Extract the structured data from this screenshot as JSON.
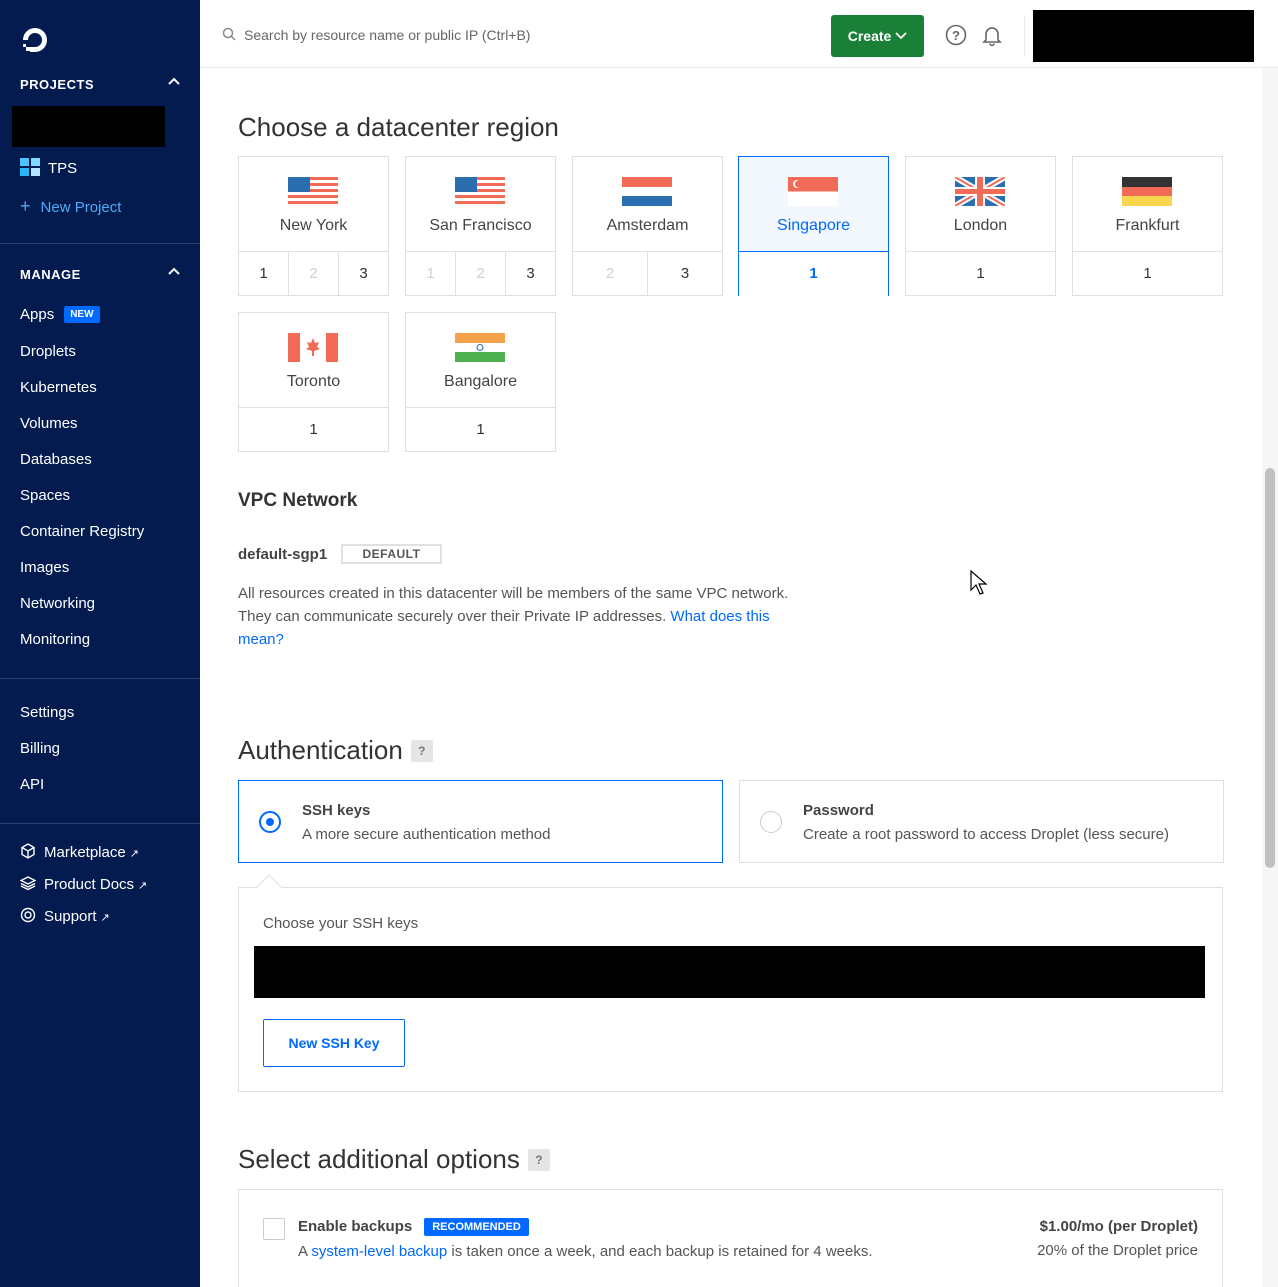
{
  "sidebar": {
    "projects_heading": "PROJECTS",
    "projects": [
      {
        "label": "TPS"
      }
    ],
    "new_project": "New Project",
    "manage_heading": "MANAGE",
    "manage_items": [
      {
        "label": "Apps",
        "badge": "NEW"
      },
      {
        "label": "Droplets"
      },
      {
        "label": "Kubernetes"
      },
      {
        "label": "Volumes"
      },
      {
        "label": "Databases"
      },
      {
        "label": "Spaces"
      },
      {
        "label": "Container Registry"
      },
      {
        "label": "Images"
      },
      {
        "label": "Networking"
      },
      {
        "label": "Monitoring"
      }
    ],
    "account_items": [
      {
        "label": "Settings"
      },
      {
        "label": "Billing"
      },
      {
        "label": "API"
      }
    ],
    "external_links": [
      {
        "label": "Marketplace",
        "icon": "marketplace-icon"
      },
      {
        "label": "Product Docs",
        "icon": "docs-icon"
      },
      {
        "label": "Support",
        "icon": "support-icon"
      }
    ]
  },
  "topbar": {
    "search_placeholder": "Search by resource name or public IP (Ctrl+B)",
    "create_label": "Create",
    "colors": {
      "create": "#1a7f37"
    }
  },
  "region_section": {
    "title": "Choose a datacenter region",
    "regions": [
      {
        "name": "New York",
        "flag": "us",
        "datacenters": [
          {
            "n": "1",
            "on": true
          },
          {
            "n": "2",
            "on": false
          },
          {
            "n": "3",
            "on": true
          }
        ],
        "selected": false
      },
      {
        "name": "San Francisco",
        "flag": "us",
        "datacenters": [
          {
            "n": "1",
            "on": false
          },
          {
            "n": "2",
            "on": false
          },
          {
            "n": "3",
            "on": true
          }
        ],
        "selected": false
      },
      {
        "name": "Amsterdam",
        "flag": "nl",
        "datacenters": [
          {
            "n": "2",
            "on": false
          },
          {
            "n": "3",
            "on": true
          }
        ],
        "selected": false
      },
      {
        "name": "Singapore",
        "flag": "sg",
        "datacenters": [
          {
            "n": "1",
            "on": true
          }
        ],
        "selected": true
      },
      {
        "name": "London",
        "flag": "uk",
        "datacenters": [
          {
            "n": "1",
            "on": true
          }
        ],
        "selected": false
      },
      {
        "name": "Frankfurt",
        "flag": "de",
        "datacenters": [
          {
            "n": "1",
            "on": true
          }
        ],
        "selected": false
      },
      {
        "name": "Toronto",
        "flag": "ca",
        "datacenters": [
          {
            "n": "1",
            "on": true
          }
        ],
        "selected": false
      },
      {
        "name": "Bangalore",
        "flag": "in",
        "datacenters": [
          {
            "n": "1",
            "on": true
          }
        ],
        "selected": false
      }
    ]
  },
  "vpc": {
    "title": "VPC Network",
    "name": "default-sgp1",
    "badge": "DEFAULT",
    "description": "All resources created in this datacenter will be members of the same VPC network. They can communicate securely over their Private IP addresses.",
    "link": "What does this mean?"
  },
  "auth": {
    "title": "Authentication",
    "help": "?",
    "options": [
      {
        "title": "SSH keys",
        "subtitle": "A more secure authentication method",
        "selected": true
      },
      {
        "title": "Password",
        "subtitle": "Create a root password to access Droplet (less secure)",
        "selected": false
      }
    ],
    "ssh_label": "Choose your SSH keys",
    "new_ssh_button": "New SSH Key"
  },
  "additional": {
    "title": "Select additional options",
    "help": "?",
    "backups": {
      "title": "Enable backups",
      "badge": "RECOMMENDED",
      "desc_prefix": "A ",
      "desc_link": "system-level backup",
      "desc_suffix": " is taken once a week, and each backup is retained for 4 weeks.",
      "price": "$1.00/mo (per Droplet)",
      "price_note": "20% of the Droplet price",
      "checked": false
    }
  }
}
